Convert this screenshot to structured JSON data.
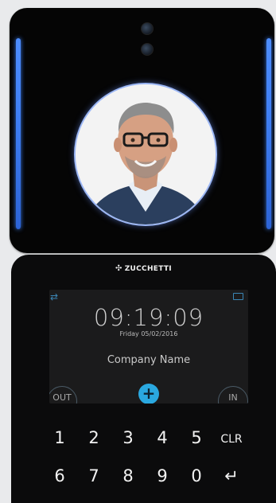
{
  "device": {
    "brand": "ZUCCHETTI",
    "brand_logo_icon": "zucchetti-logo-icon",
    "led_color": "#3f7ff5",
    "accent": "#2aa8e0"
  },
  "display": {
    "time": "09:19:09",
    "date": "Friday 05/02/2016",
    "company": "Company Name",
    "out_label": "OUT",
    "in_label": "IN",
    "add_symbol": "+"
  },
  "keypad": {
    "row1": [
      "1",
      "2",
      "3",
      "4",
      "5",
      "CLR"
    ],
    "row2": [
      "6",
      "7",
      "8",
      "9",
      "0",
      "↵"
    ]
  }
}
